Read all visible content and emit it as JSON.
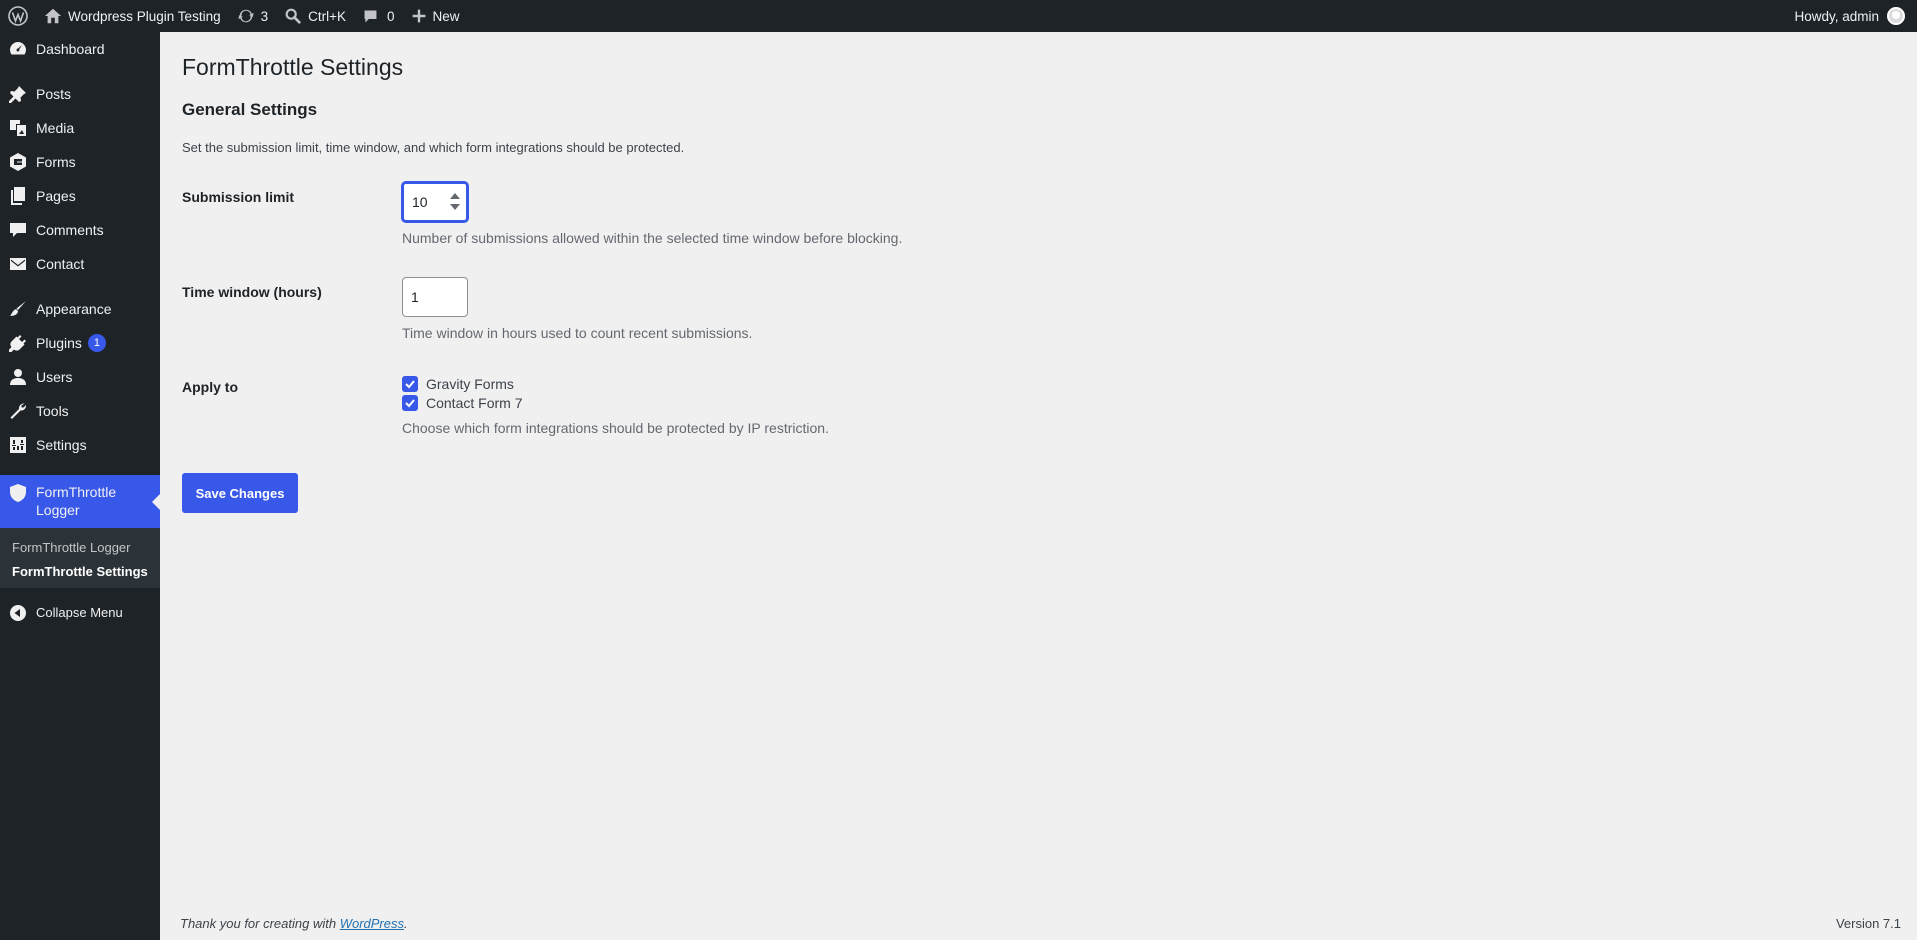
{
  "adminbar": {
    "site_name": "Wordpress Plugin Testing",
    "updates_count": "3",
    "search_shortcut": "Ctrl+K",
    "comments_count": "0",
    "new_label": "New",
    "greeting": "Howdy, admin"
  },
  "sidebar": {
    "items": [
      {
        "label": "Dashboard",
        "icon": "dashboard-icon"
      },
      {
        "label": "Posts",
        "icon": "pin-icon"
      },
      {
        "label": "Media",
        "icon": "media-icon"
      },
      {
        "label": "Forms",
        "icon": "forms-icon"
      },
      {
        "label": "Pages",
        "icon": "pages-icon"
      },
      {
        "label": "Comments",
        "icon": "comment-icon"
      },
      {
        "label": "Contact",
        "icon": "mail-icon"
      },
      {
        "label": "Appearance",
        "icon": "brush-icon"
      },
      {
        "label": "Plugins",
        "icon": "plugin-icon",
        "badge": "1"
      },
      {
        "label": "Users",
        "icon": "user-icon"
      },
      {
        "label": "Tools",
        "icon": "wrench-icon"
      },
      {
        "label": "Settings",
        "icon": "settings-icon"
      },
      {
        "label": "FormThrottle Logger",
        "icon": "shield-icon"
      }
    ],
    "submenu": [
      "FormThrottle Logger",
      "FormThrottle Settings"
    ],
    "collapse_label": "Collapse Menu"
  },
  "page": {
    "title": "FormThrottle Settings",
    "section_title": "General Settings",
    "section_desc": "Set the submission limit, time window, and which form integrations should be protected.",
    "fields": {
      "submission_limit": {
        "label": "Submission limit",
        "value": "10",
        "desc": "Number of submissions allowed within the selected time window before blocking."
      },
      "time_window": {
        "label": "Time window (hours)",
        "value": "1",
        "desc": "Time window in hours used to count recent submissions."
      },
      "apply_to": {
        "label": "Apply to",
        "options": [
          "Gravity Forms",
          "Contact Form 7"
        ],
        "desc": "Choose which form integrations should be protected by IP restriction."
      }
    },
    "save_label": "Save Changes"
  },
  "footer": {
    "thanks": "Thank you for creating with ",
    "link": "WordPress",
    "after_link": ".",
    "version": "Version 7.1"
  },
  "colors": {
    "accent": "#3858e9",
    "sidebar_bg": "#1d2327",
    "page_bg": "#f0f0f1"
  }
}
